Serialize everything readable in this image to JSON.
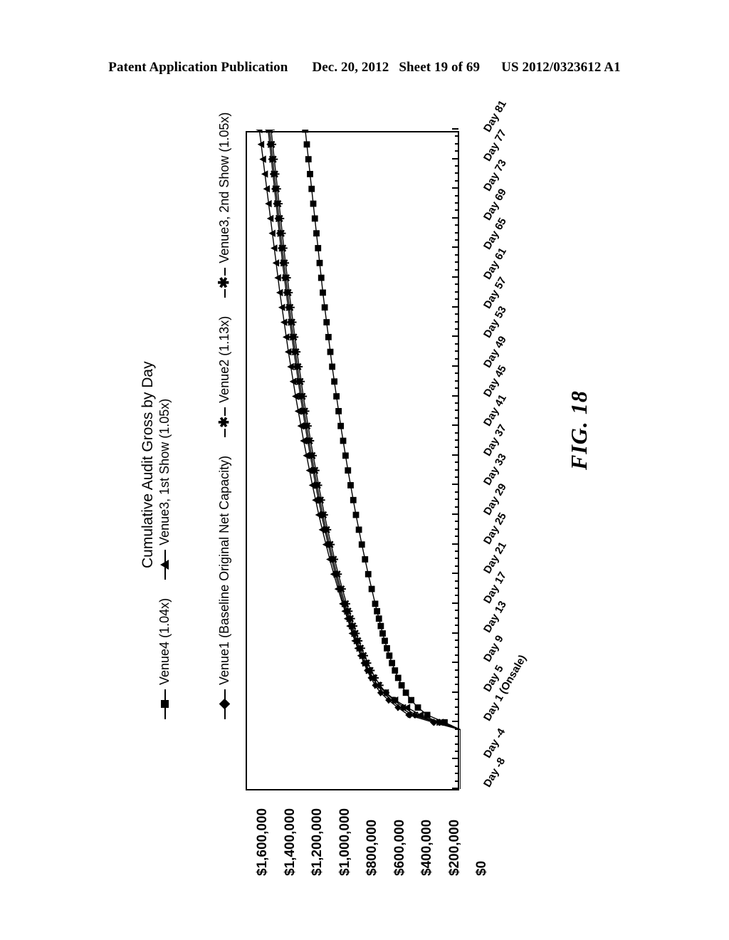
{
  "patent_header": {
    "publication": "Patent Application Publication",
    "date": "Dec. 20, 2012",
    "sheet": "Sheet 19 of 69",
    "number": "US 2012/0323612 A1"
  },
  "figure": {
    "caption": "FIG. 18"
  },
  "chart_data": {
    "type": "line",
    "title": "Cumulative Audit Gross by Day",
    "xlabel": "",
    "ylabel": "",
    "grid": true,
    "legend_position": "top",
    "orientation": "rotated-90-ccw",
    "ylim": [
      0,
      1600000
    ],
    "yticks": [
      "$1,600,000",
      "$1,400,000",
      "$1,200,000",
      "$1,000,000",
      "$800,000",
      "$600,000",
      "$400,000",
      "$200,000",
      "$0"
    ],
    "ytick_values": [
      1600000,
      1400000,
      1200000,
      1000000,
      800000,
      600000,
      400000,
      200000,
      0
    ],
    "xticks": [
      "Day -8",
      "Day -4",
      "Day 1 (Onsale)",
      "Day 5",
      "Day 9",
      "Day 13",
      "Day 17",
      "Day 21",
      "Day 25",
      "Day 29",
      "Day 33",
      "Day 37",
      "Day 41",
      "Day 45",
      "Day 49",
      "Day 53",
      "Day 57",
      "Day 61",
      "Day 65",
      "Day 69",
      "Day 73",
      "Day 77",
      "Day 81"
    ],
    "xtick_values": [
      -8,
      -4,
      1,
      5,
      9,
      13,
      17,
      21,
      25,
      29,
      33,
      37,
      41,
      45,
      49,
      53,
      57,
      61,
      65,
      69,
      73,
      77,
      81
    ],
    "x": [
      -8,
      -6,
      -4,
      -2,
      0,
      1,
      2,
      3,
      4,
      5,
      6,
      7,
      8,
      9,
      10,
      11,
      12,
      13,
      14,
      15,
      16,
      17,
      19,
      21,
      23,
      25,
      27,
      29,
      31,
      33,
      35,
      37,
      39,
      41,
      43,
      45,
      47,
      49,
      51,
      53,
      55,
      57,
      59,
      61,
      63,
      65,
      67,
      69,
      71,
      73,
      75,
      77,
      79,
      81
    ],
    "series": [
      {
        "name": "Venue1 (Baseline Original Net Capacity)",
        "marker": "diamond",
        "values": [
          0,
          0,
          0,
          0,
          0,
          205000,
          390000,
          470000,
          540000,
          600000,
          640000,
          672000,
          700000,
          724000,
          746000,
          766000,
          786000,
          804000,
          822000,
          840000,
          858000,
          876000,
          908000,
          938000,
          966000,
          992000,
          1018000,
          1042000,
          1064000,
          1086000,
          1106000,
          1126000,
          1146000,
          1164000,
          1182000,
          1200000,
          1216000,
          1232000,
          1248000,
          1264000,
          1278000,
          1292000,
          1306000,
          1320000,
          1334000,
          1346000,
          1358000,
          1370000,
          1382000,
          1394000,
          1406000,
          1418000,
          1430000,
          1442000
        ]
      },
      {
        "name": "Venue4 (1.04x)",
        "marker": "square",
        "values": [
          0,
          0,
          0,
          0,
          0,
          120000,
          250000,
          320000,
          370000,
          410000,
          442000,
          468000,
          492000,
          514000,
          534000,
          552000,
          568000,
          584000,
          598000,
          612000,
          626000,
          640000,
          666000,
          692000,
          716000,
          740000,
          762000,
          784000,
          804000,
          824000,
          844000,
          862000,
          880000,
          898000,
          914000,
          930000,
          946000,
          962000,
          976000,
          990000,
          1004000,
          1018000,
          1032000,
          1044000,
          1056000,
          1068000,
          1080000,
          1092000,
          1104000,
          1116000,
          1128000,
          1140000,
          1152000,
          1164000
        ]
      },
      {
        "name": "Venue3, 1st Show (1.05x)",
        "marker": "triangle",
        "values": [
          0,
          0,
          0,
          0,
          0,
          150000,
          300000,
          400000,
          490000,
          560000,
          620000,
          660000,
          694000,
          722000,
          748000,
          770000,
          792000,
          812000,
          830000,
          848000,
          866000,
          884000,
          918000,
          950000,
          980000,
          1008000,
          1036000,
          1062000,
          1086000,
          1110000,
          1132000,
          1154000,
          1176000,
          1196000,
          1216000,
          1236000,
          1254000,
          1272000,
          1290000,
          1306000,
          1322000,
          1338000,
          1354000,
          1368000,
          1382000,
          1396000,
          1410000,
          1424000,
          1438000,
          1452000,
          1466000,
          1480000,
          1494000,
          1508000
        ]
      },
      {
        "name": "Venue2 (1.13x)",
        "marker": "x",
        "values": [
          0,
          0,
          0,
          0,
          0,
          180000,
          360000,
          450000,
          520000,
          580000,
          622000,
          656000,
          686000,
          712000,
          734000,
          756000,
          776000,
          794000,
          812000,
          830000,
          848000,
          866000,
          898000,
          928000,
          956000,
          982000,
          1008000,
          1032000,
          1054000,
          1076000,
          1096000,
          1116000,
          1136000,
          1154000,
          1172000,
          1190000,
          1206000,
          1222000,
          1238000,
          1254000,
          1268000,
          1282000,
          1296000,
          1310000,
          1324000,
          1336000,
          1348000,
          1360000,
          1372000,
          1384000,
          1396000,
          1408000,
          1420000,
          1432000
        ]
      },
      {
        "name": "Venue3, 2nd Show (1.05x)",
        "marker": "star",
        "values": [
          0,
          0,
          0,
          0,
          0,
          165000,
          335000,
          425000,
          500000,
          560000,
          604000,
          640000,
          670000,
          696000,
          720000,
          742000,
          762000,
          782000,
          800000,
          818000,
          836000,
          854000,
          886000,
          916000,
          944000,
          970000,
          996000,
          1020000,
          1042000,
          1064000,
          1084000,
          1104000,
          1124000,
          1142000,
          1160000,
          1178000,
          1194000,
          1210000,
          1226000,
          1242000,
          1256000,
          1270000,
          1284000,
          1298000,
          1312000,
          1324000,
          1336000,
          1348000,
          1360000,
          1372000,
          1384000,
          1396000,
          1408000,
          1420000
        ]
      }
    ]
  },
  "legend": {
    "items": [
      {
        "label": "Venue1 (Baseline Original Net Capacity)",
        "marker": "diamond"
      },
      {
        "label": "Venue2 (1.13x)",
        "marker": "x"
      },
      {
        "label": "Venue3, 2nd Show (1.05x)",
        "marker": "star"
      },
      {
        "label": "Venue4 (1.04x)",
        "marker": "square"
      },
      {
        "label": "Venue3, 1st Show (1.05x)",
        "marker": "triangle"
      }
    ]
  }
}
